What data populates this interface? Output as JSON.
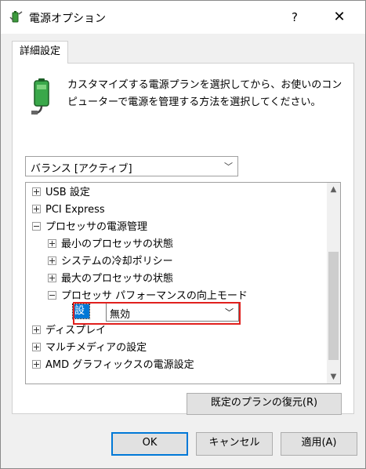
{
  "window": {
    "title": "電源オプション",
    "help": "?",
    "close": "✕"
  },
  "tab": {
    "label": "詳細設定"
  },
  "description": "カスタマイズする電源プランを選択してから、お使いのコンピューターで電源を管理する方法を選択してください。",
  "plan_select": {
    "value": "バランス [アクティブ]"
  },
  "tree": {
    "items": [
      {
        "label": "USB 設定",
        "expander": "+"
      },
      {
        "label": "PCI Express",
        "expander": "+"
      },
      {
        "label": "プロセッサの電源管理",
        "expander": "-"
      },
      {
        "label": "最小のプロセッサの状態",
        "expander": "+"
      },
      {
        "label": "システムの冷却ポリシー",
        "expander": "+"
      },
      {
        "label": "最大のプロセッサの状態",
        "expander": "+"
      },
      {
        "label": "プロセッサ パフォーマンスの向上モード",
        "expander": "-"
      },
      {
        "label": "ディスプレイ",
        "expander": "+"
      },
      {
        "label": "マルチメディアの設定",
        "expander": "+"
      },
      {
        "label": "AMD グラフィックスの電源設定",
        "expander": "+"
      }
    ],
    "setting": {
      "label": "設定:",
      "value": "無効"
    }
  },
  "buttons": {
    "restore": "既定のプランの復元(R)",
    "ok": "OK",
    "cancel": "キャンセル",
    "apply": "適用(A)"
  },
  "colors": {
    "highlight": "#e1201d",
    "selection": "#0078d7"
  }
}
